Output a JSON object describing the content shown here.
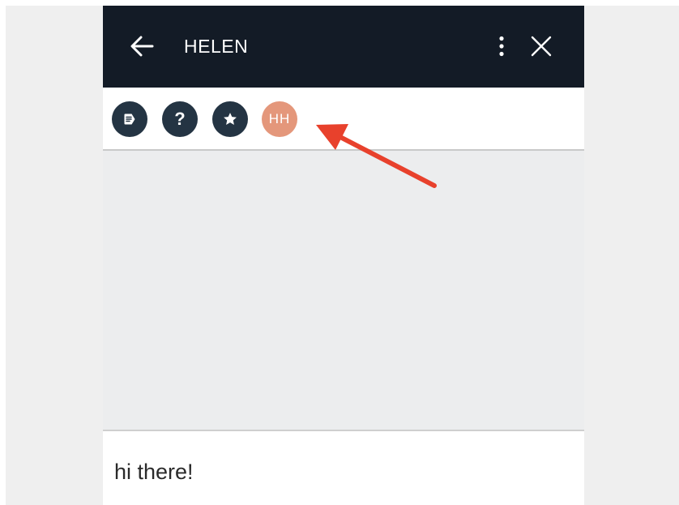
{
  "header": {
    "title": "HELEN",
    "icons": {
      "back": "arrow-left-icon",
      "more": "more-vertical-icon",
      "close": "close-icon"
    }
  },
  "toolbar": {
    "buttons": [
      {
        "name": "notes",
        "icon": "note-icon"
      },
      {
        "name": "help",
        "icon": "question-icon",
        "glyph": "?"
      },
      {
        "name": "favorite",
        "icon": "star-icon"
      },
      {
        "name": "avatar",
        "initials": "HH"
      }
    ]
  },
  "composer": {
    "value": "hi there!"
  },
  "colors": {
    "header_bg": "#131b26",
    "button_bg": "#243443",
    "avatar_bg": "#e4977b",
    "annotation_arrow": "#e8412c",
    "content_bg": "#ecedee"
  }
}
